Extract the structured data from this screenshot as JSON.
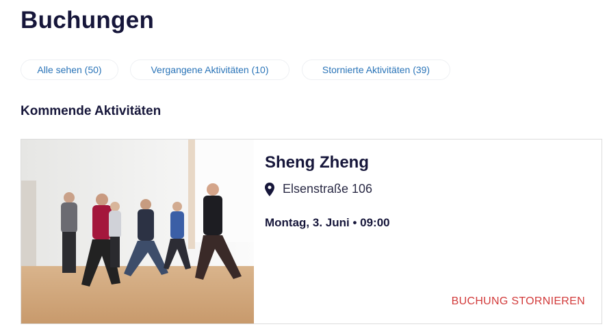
{
  "page_title": "Buchungen",
  "filters": [
    {
      "label": "Alle sehen (50)"
    },
    {
      "label": "Vergangene Aktivitäten (10)"
    },
    {
      "label": "Stornierte Aktivitäten (39)"
    }
  ],
  "section_title": "Kommende Aktivitäten",
  "booking": {
    "name": "Sheng Zheng",
    "location_icon": "map-pin-icon",
    "address": "Elsenstraße 106",
    "datetime": "Montag, 3. Juni • 09:00",
    "cancel_label": "BUCHUNG STORNIEREN"
  },
  "colors": {
    "primary": "#16163a",
    "link": "#2a74b8",
    "danger": "#d23a3a"
  }
}
